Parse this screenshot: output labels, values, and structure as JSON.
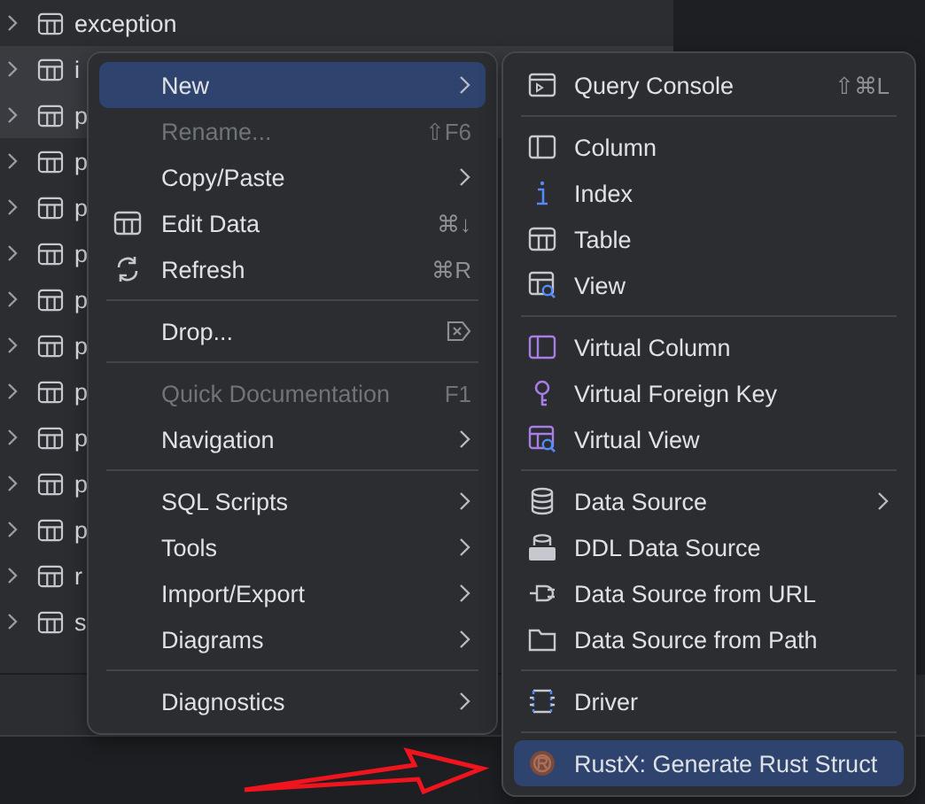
{
  "tree": {
    "rows": [
      {
        "label": "exception"
      },
      {
        "label": "i"
      },
      {
        "label": "p"
      },
      {
        "label": "p"
      },
      {
        "label": "p"
      },
      {
        "label": "p"
      },
      {
        "label": "p"
      },
      {
        "label": "p"
      },
      {
        "label": "p"
      },
      {
        "label": "p"
      },
      {
        "label": "p"
      },
      {
        "label": "p"
      },
      {
        "label": "r"
      },
      {
        "label": "s"
      }
    ]
  },
  "context_menu": {
    "items": [
      {
        "kind": "item",
        "label": "New",
        "submenu": true,
        "selected": true,
        "disabled": false
      },
      {
        "kind": "item",
        "label": "Rename...",
        "shortcut": "⇧F6",
        "submenu": false,
        "selected": false,
        "disabled": true
      },
      {
        "kind": "item",
        "label": "Copy/Paste",
        "submenu": true,
        "selected": false,
        "disabled": false
      },
      {
        "kind": "item",
        "label": "Edit Data",
        "shortcut": "⌘↓",
        "submenu": false,
        "selected": false,
        "disabled": false
      },
      {
        "kind": "item",
        "label": "Refresh",
        "shortcut": "⌘R",
        "submenu": false,
        "selected": false,
        "disabled": false
      },
      {
        "kind": "separator"
      },
      {
        "kind": "item",
        "label": "Drop...",
        "submenu": false,
        "selected": false,
        "disabled": false
      },
      {
        "kind": "separator"
      },
      {
        "kind": "item",
        "label": "Quick Documentation",
        "shortcut": "F1",
        "submenu": false,
        "selected": false,
        "disabled": true
      },
      {
        "kind": "item",
        "label": "Navigation",
        "submenu": true,
        "selected": false,
        "disabled": false
      },
      {
        "kind": "separator"
      },
      {
        "kind": "item",
        "label": "SQL Scripts",
        "submenu": true,
        "selected": false,
        "disabled": false
      },
      {
        "kind": "item",
        "label": "Tools",
        "submenu": true,
        "selected": false,
        "disabled": false
      },
      {
        "kind": "item",
        "label": "Import/Export",
        "submenu": true,
        "selected": false,
        "disabled": false
      },
      {
        "kind": "item",
        "label": "Diagrams",
        "submenu": true,
        "selected": false,
        "disabled": false
      },
      {
        "kind": "separator"
      },
      {
        "kind": "item",
        "label": "Diagnostics",
        "submenu": true,
        "selected": false,
        "disabled": false
      }
    ]
  },
  "new_submenu": {
    "items": [
      {
        "kind": "item",
        "label": "Query Console",
        "shortcut": "⇧⌘L",
        "submenu": false,
        "selected": false,
        "disabled": false
      },
      {
        "kind": "separator"
      },
      {
        "kind": "item",
        "label": "Column",
        "submenu": false,
        "selected": false,
        "disabled": false
      },
      {
        "kind": "item",
        "label": "Index",
        "submenu": false,
        "selected": false,
        "disabled": false
      },
      {
        "kind": "item",
        "label": "Table",
        "submenu": false,
        "selected": false,
        "disabled": false
      },
      {
        "kind": "item",
        "label": "View",
        "submenu": false,
        "selected": false,
        "disabled": false
      },
      {
        "kind": "separator"
      },
      {
        "kind": "item",
        "label": "Virtual Column",
        "submenu": false,
        "selected": false,
        "disabled": false
      },
      {
        "kind": "item",
        "label": "Virtual Foreign Key",
        "submenu": false,
        "selected": false,
        "disabled": false
      },
      {
        "kind": "item",
        "label": "Virtual View",
        "submenu": false,
        "selected": false,
        "disabled": false
      },
      {
        "kind": "separator"
      },
      {
        "kind": "item",
        "label": "Data Source",
        "submenu": true,
        "selected": false,
        "disabled": false
      },
      {
        "kind": "item",
        "label": "DDL Data Source",
        "submenu": false,
        "selected": false,
        "disabled": false
      },
      {
        "kind": "item",
        "label": "Data Source from URL",
        "submenu": false,
        "selected": false,
        "disabled": false
      },
      {
        "kind": "item",
        "label": "Data Source from Path",
        "submenu": false,
        "selected": false,
        "disabled": false
      },
      {
        "kind": "separator"
      },
      {
        "kind": "item",
        "label": "Driver",
        "submenu": false,
        "selected": false,
        "disabled": false
      },
      {
        "kind": "separator"
      },
      {
        "kind": "item",
        "label": "RustX: Generate Rust Struct",
        "submenu": false,
        "selected": true,
        "disabled": false
      }
    ]
  }
}
